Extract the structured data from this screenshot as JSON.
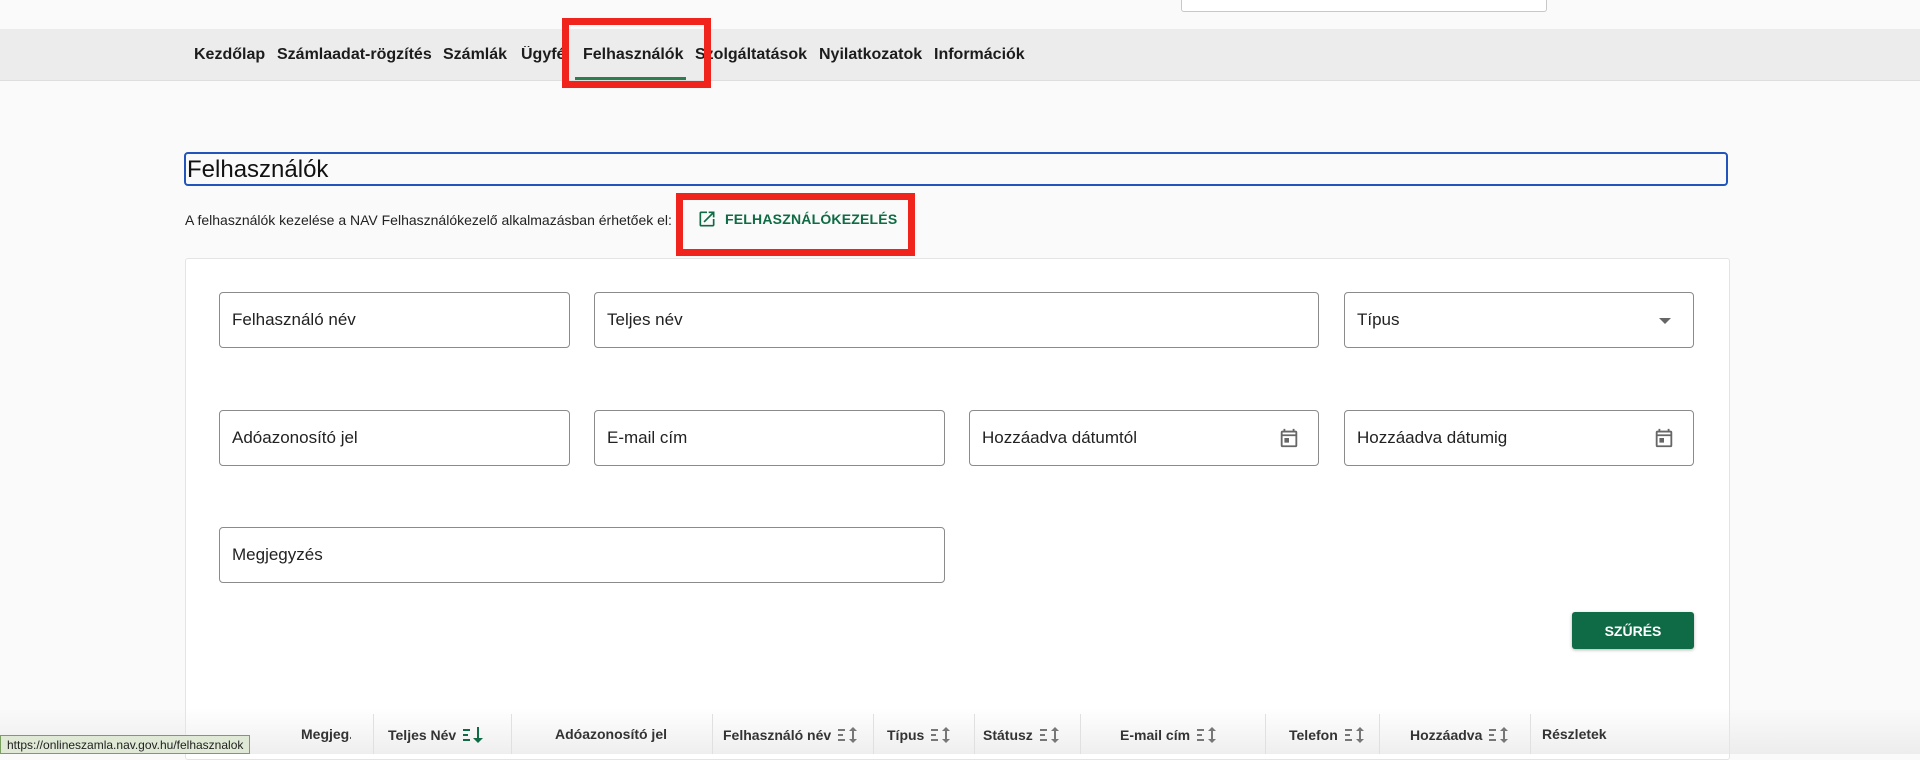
{
  "nav": {
    "items": [
      "Kezdőlap",
      "Számlaadat-rögzítés",
      "Számlák",
      "Ügyfé",
      "Felhasználók",
      "Szolgáltatások",
      "Nyilatkozatok",
      "Információk"
    ],
    "active": "Felhasználók"
  },
  "page": {
    "title": "Felhasználók",
    "description": "A felhasználók kezelése a NAV Felhasználókezelő alkalmazásban érhetőek el:",
    "link_label": "FELHASZNÁLÓKEZELÉS"
  },
  "filters": {
    "username": "Felhasználó név",
    "fullname": "Teljes név",
    "type": "Típus",
    "taxid": "Adóazonosító jel",
    "email": "E-mail cím",
    "added_from": "Hozzáadva dátumtól",
    "added_to": "Hozzáadva dátumig",
    "note": "Megjegyzés",
    "filter_button": "SZŰRÉS"
  },
  "table": {
    "headers": [
      "Megjeg...",
      "Teljes Név",
      "Adóazonosító jel",
      "Felhasználó név",
      "Típus",
      "Státusz",
      "E-mail cím",
      "Telefon",
      "Hozzáadva",
      "Részletek"
    ]
  },
  "status_bar": {
    "url": "https://onlineszamla.nav.gov.hu/felhasznalok"
  },
  "colors": {
    "accent": "#0f6b46",
    "highlight": "#f0231d",
    "focus": "#2255bb"
  },
  "icons": [
    "open-in-new-icon",
    "calendar-icon",
    "sort-icon",
    "sort-active-icon",
    "dropdown-arrow-icon"
  ]
}
